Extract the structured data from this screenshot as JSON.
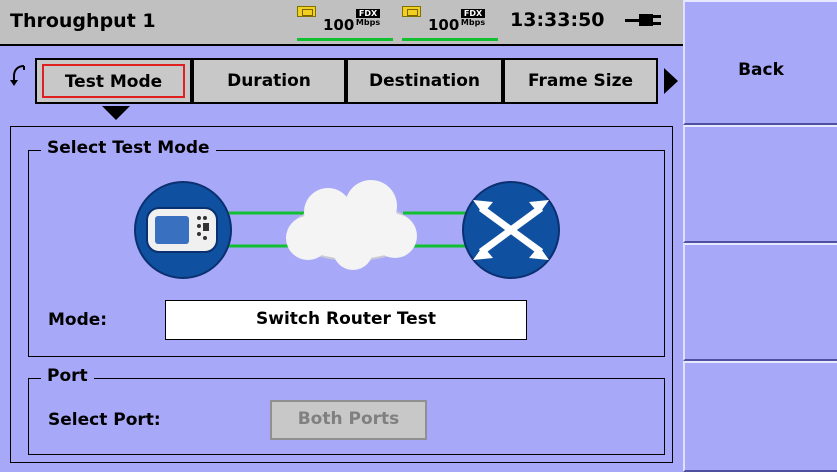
{
  "header": {
    "title": "Throughput 1",
    "port_a": {
      "speed": "100",
      "duplex": "FDX",
      "unit": "Mbps"
    },
    "port_b": {
      "speed": "100",
      "duplex": "FDX",
      "unit": "Mbps"
    },
    "clock": "13:33:50",
    "power_icon": "plug-icon"
  },
  "tabs": [
    {
      "label": "Test Mode",
      "selected": true
    },
    {
      "label": "Duration"
    },
    {
      "label": "Destination"
    },
    {
      "label": "Frame Size"
    }
  ],
  "softkeys": {
    "back": "Back"
  },
  "test_mode": {
    "legend": "Select Test Mode",
    "mode_label": "Mode:",
    "mode_value": "Switch Router Test",
    "diagram_icons": [
      "tester-device-icon",
      "network-cloud-icon",
      "switch-router-icon"
    ]
  },
  "port": {
    "legend": "Port",
    "select_label": "Select Port:",
    "select_value": "Both Ports"
  },
  "colors": {
    "background": "#a8a8f8",
    "title_bar": "#c0c0c0",
    "selected_tab_outline": "#e02020",
    "link_green": "#10c030",
    "icon_blue": "#1050a0"
  }
}
